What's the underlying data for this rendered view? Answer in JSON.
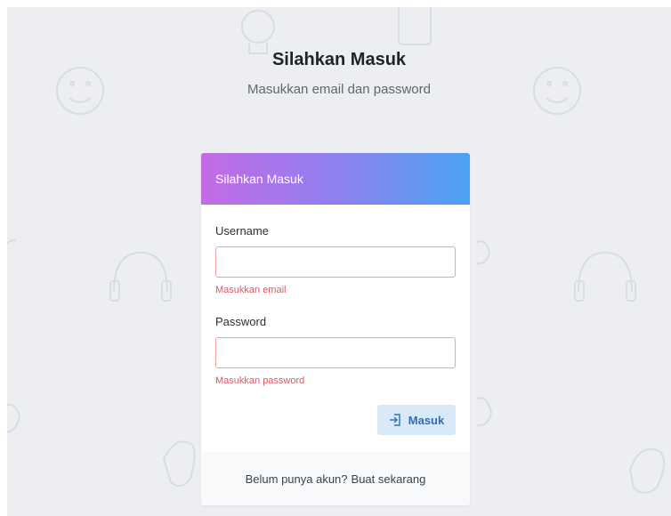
{
  "page": {
    "heading": "Silahkan Masuk",
    "subheading": "Masukkan email dan password"
  },
  "card": {
    "header_title": "Silahkan Masuk",
    "username": {
      "label": "Username",
      "value": "",
      "error": "Masukkan email"
    },
    "password": {
      "label": "Password",
      "value": "",
      "error": "Masukkan password"
    },
    "submit_label": "Masuk",
    "submit_icon": "login-icon",
    "footer": {
      "prompt": "Belum punya akun?",
      "link": "Buat sekarang"
    }
  },
  "colors": {
    "header_gradient_start": "#c46ae6",
    "header_gradient_end": "#4aa2f3",
    "error": "#e2555e",
    "button_bg": "#d8e9f8",
    "button_text": "#2f6fae",
    "background": "#eceef1"
  }
}
